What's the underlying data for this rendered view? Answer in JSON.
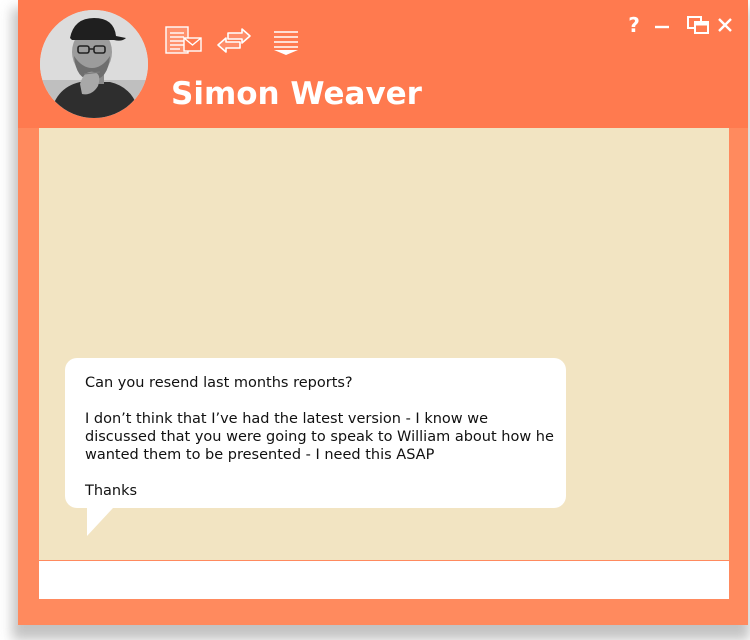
{
  "header": {
    "contact_name": "Simon Weaver",
    "avatar_alt": "Contact avatar",
    "toolbar_icons": [
      "email-icon",
      "transfer-arrows-icon",
      "menu-collapse-icon"
    ],
    "window_controls": {
      "help_label": "?",
      "icons": [
        "help-icon",
        "minimize-icon",
        "restore-icon",
        "close-icon"
      ]
    }
  },
  "messages": [
    {
      "paragraphs": [
        "Can you resend last months reports?",
        "I don’t think that I’ve had the latest version - I know we discussed that you were going to speak to William about how he wanted them to be presented - I need this ASAP",
        "Thanks"
      ]
    }
  ],
  "composer": {
    "value": "",
    "placeholder": ""
  },
  "colors": {
    "header_bg": "#ff7a4f",
    "frame_bg": "#ff8a5e",
    "chat_bg": "#f2e4c2",
    "bubble_bg": "#ffffff",
    "header_text": "#ffffff"
  }
}
